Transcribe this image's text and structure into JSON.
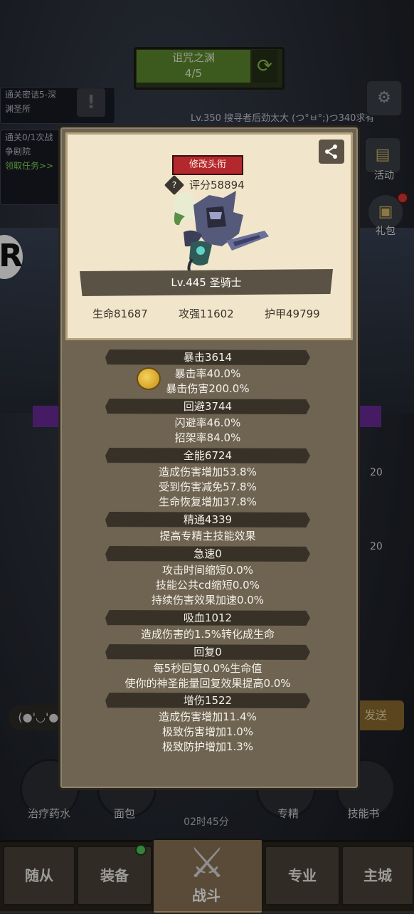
{
  "background": {
    "dungeon": {
      "name": "诅咒之渊",
      "progress": "4/5"
    },
    "quests": [
      {
        "line1": "通关密诘5-深",
        "line2": "渊圣所"
      },
      {
        "line1": "通关0/1次战",
        "line2": "争剧院"
      }
    ],
    "claim_task": "领取任务>>",
    "player_strip": "Lv.350 搜寻者后劲太大  (つ°ㅂ°;)つ340求有",
    "side_buttons": [
      {
        "label": "活动",
        "icon": "calendar-icon"
      },
      {
        "label": "礼包",
        "icon": "gift-icon"
      }
    ],
    "chat_text": "(●'◡'●)",
    "send_label": "发送",
    "potions": [
      {
        "label": "治疗药水"
      },
      {
        "label": "面包"
      },
      {
        "label": "专精"
      },
      {
        "label": "技能书"
      }
    ],
    "timer": "02时45分",
    "slot_badges": [
      "20",
      "20"
    ],
    "tabs": {
      "followers": "随从",
      "equipment": "装备",
      "battle": "战斗",
      "profession": "专业",
      "city": "主城"
    }
  },
  "panel": {
    "edit_title": "修改头衔",
    "score": "评分58894",
    "level_class": "Lv.445 圣骑士",
    "base_stats": {
      "hp": "生命81687",
      "attack": "攻强11602",
      "armor": "护甲49799"
    },
    "sections": [
      {
        "header": "暴击3614",
        "lines": [
          "暴击率40.0%",
          "暴击伤害200.0%"
        ]
      },
      {
        "header": "回避3744",
        "lines": [
          "闪避率46.0%",
          "招架率84.0%"
        ]
      },
      {
        "header": "全能6724",
        "lines": [
          "造成伤害增加53.8%",
          "受到伤害减免57.8%",
          "生命恢复增加37.8%"
        ]
      },
      {
        "header": "精通4339",
        "lines": [
          "提高专精主技能效果"
        ]
      },
      {
        "header": "急速0",
        "lines": [
          "攻击时间缩短0.0%",
          "技能公共cd缩短0.0%",
          "持续伤害效果加速0.0%"
        ]
      },
      {
        "header": "吸血1012",
        "lines": [
          "造成伤害的1.5%转化成生命"
        ]
      },
      {
        "header": "回复0",
        "lines": [
          "每5秒回复0.0%生命值",
          "使你的神圣能量回复效果提高0.0%"
        ]
      },
      {
        "header": "增伤1522",
        "lines": [
          "造成伤害增加11.4%",
          "极致伤害增加1.0%",
          "极致防护增加1.3%"
        ]
      }
    ]
  },
  "colors": {
    "panel_bg": "#6f6452",
    "card_bg": "#f1e6cb",
    "header_bar": "#383128",
    "edit_button": "#b3282c"
  }
}
